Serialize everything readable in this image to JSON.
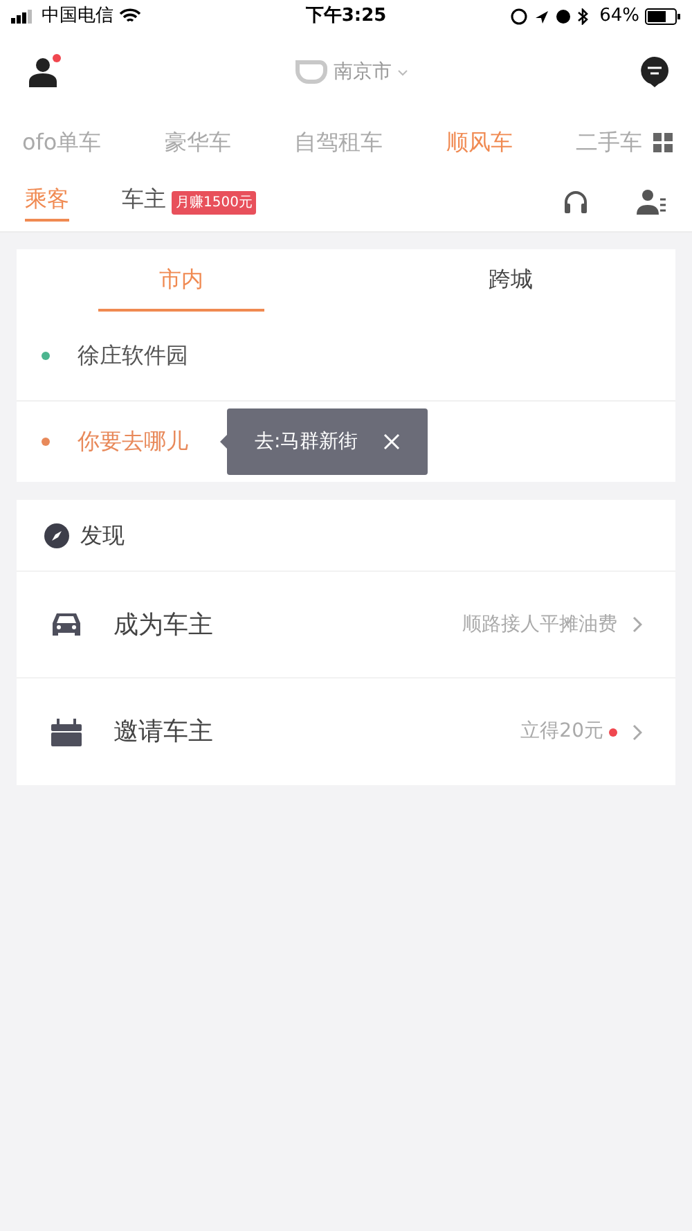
{
  "status_bar": {
    "carrier": "中国电信",
    "time": "下午3:25",
    "battery": "64%"
  },
  "header": {
    "city": "南京市",
    "avatar_notification": true
  },
  "service_tabs": [
    {
      "label": "ofo单车",
      "selected": false
    },
    {
      "label": "豪华车",
      "selected": false
    },
    {
      "label": "自驾租车",
      "selected": false
    },
    {
      "label": "顺风车",
      "selected": true
    },
    {
      "label": "二手车",
      "selected": false
    }
  ],
  "role_tabs": [
    {
      "label": "乘客",
      "selected": true
    },
    {
      "label": "车主",
      "selected": false,
      "badge": "月赚1500元"
    }
  ],
  "trip_card": {
    "tabs": [
      {
        "label": "市内",
        "selected": true
      },
      {
        "label": "跨城",
        "selected": false
      }
    ],
    "origin": {
      "text": "徐庄软件园",
      "color": "#4cb58f"
    },
    "destination": {
      "placeholder": "你要去哪儿",
      "color": "#e8895a"
    },
    "suggestion": {
      "text": "去:马群新街"
    }
  },
  "discover": {
    "title": "发现",
    "items": [
      {
        "kind": "car",
        "title": "成为车主",
        "note": "顺路接人平摊油费",
        "dot": false
      },
      {
        "kind": "gift",
        "title": "邀请车主",
        "note": "立得20元",
        "dot": true
      }
    ]
  }
}
